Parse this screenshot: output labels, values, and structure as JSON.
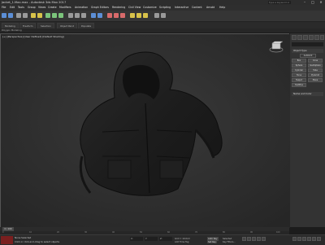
{
  "window": {
    "title": "Jacket_1.Max.max - Autodesk 3ds Max 2017",
    "search_placeholder": "Type a keyword or phrase",
    "minimize": "–",
    "maximize": "□",
    "close": "✕"
  },
  "menu": [
    "File",
    "Edit",
    "Tools",
    "Group",
    "Views",
    "Create",
    "Modifiers",
    "Animation",
    "Graph Editors",
    "Rendering",
    "Civil View",
    "Customize",
    "Scripting",
    "Interactive",
    "Content",
    "Arnold",
    "Help"
  ],
  "toolbar_colors": [
    "#5c8fd6",
    "#d8c24a",
    "#7bc47b",
    "#d86a6a",
    "#9a9a9a"
  ],
  "ribbon": {
    "tabs": [
      "Modeling",
      "Freeform",
      "Selection",
      "Object Paint",
      "Populate"
    ],
    "sub": "Polygon Modeling"
  },
  "viewport": {
    "label": "[+] [Perspective] [User Defined] [Default Shading]",
    "background": "#2f2f2f"
  },
  "command_panel": {
    "field": "",
    "section_object_type": "Object Type",
    "autogrid": "AutoGrid",
    "buttons": [
      "Box",
      "Cone",
      "Sphere",
      "GeoSphere",
      "Cylinder",
      "Tube",
      "Torus",
      "Pyramid",
      "Teapot",
      "Plane",
      "TextPlus"
    ],
    "section_name": "Name and Color"
  },
  "timeline": {
    "slider": "0 / 100",
    "ticks": [
      "0",
      "10",
      "20",
      "30",
      "40",
      "50",
      "60",
      "70",
      "80",
      "90",
      "100"
    ]
  },
  "status": {
    "line1": "None Selected",
    "line2": "Click or click-and-drag to select objects",
    "x": "X:",
    "y": "Y:",
    "z": "Z:",
    "grid": "Grid = 10.0cm",
    "add_time_tag": "Add Time Tag",
    "autokey": "Auto Key",
    "selected": "Selected",
    "set_key": "Set Key",
    "key_filters": "Key Filters..."
  }
}
